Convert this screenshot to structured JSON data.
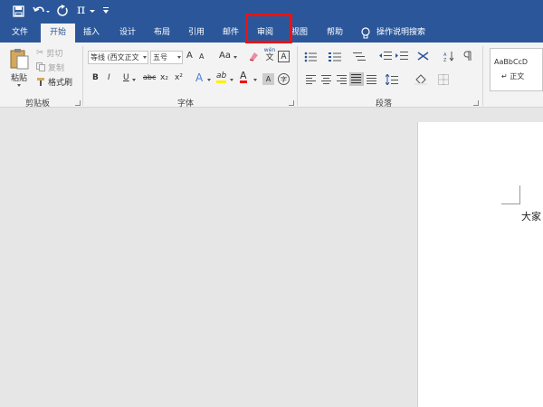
{
  "titlebar": {
    "pi_symbol": "π"
  },
  "tabs": [
    "文件",
    "开始",
    "插入",
    "设计",
    "布局",
    "引用",
    "邮件",
    "审阅",
    "视图",
    "帮助",
    "操作说明搜索"
  ],
  "clipboard": {
    "paste": "粘贴",
    "cut": "剪切",
    "copy": "复制",
    "format_painter": "格式刷",
    "group": "剪贴板"
  },
  "font": {
    "name": "等线 (西文正文",
    "size": "五号",
    "grow": "A",
    "shrink": "A",
    "case": "Aa",
    "bold": "B",
    "italic": "I",
    "underline": "U",
    "strike": "abc",
    "sub": "x₂",
    "sup": "x²",
    "effects": "A",
    "highlight": "ab",
    "color": "A",
    "pinyin_top": "wén",
    "pinyin_bottom": "文",
    "char_border": "A",
    "enclose": "字",
    "group": "字体"
  },
  "paragraph": {
    "group": "段落"
  },
  "styles": {
    "sample": "AaBbCcD",
    "name": "↵ 正文"
  },
  "document": {
    "text": "大家"
  },
  "colors": {
    "brand": "#2b579a",
    "highlight_box": "#e11111"
  }
}
